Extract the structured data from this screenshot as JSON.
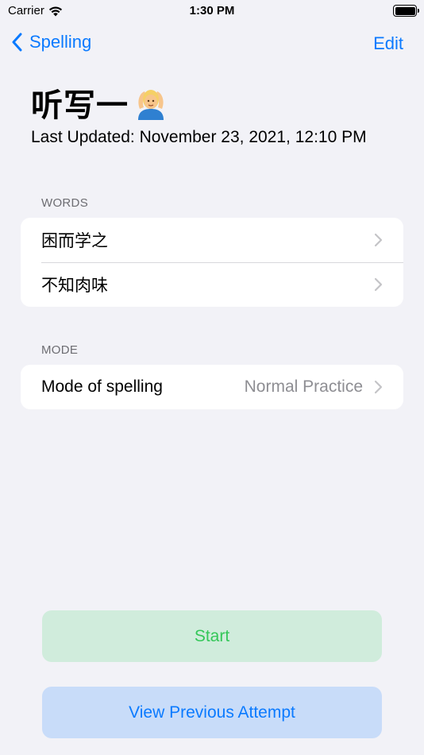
{
  "status": {
    "carrier": "Carrier",
    "time": "1:30 PM"
  },
  "nav": {
    "back_label": "Spelling",
    "edit_label": "Edit"
  },
  "header": {
    "title": "听写一",
    "updated": "Last Updated: November 23, 2021, 12:10 PM"
  },
  "words": {
    "header": "WORDS",
    "items": [
      {
        "label": "困而学之"
      },
      {
        "label": "不知肉味"
      }
    ]
  },
  "mode": {
    "header": "MODE",
    "label": "Mode of spelling",
    "value": "Normal Practice"
  },
  "buttons": {
    "start": "Start",
    "view_previous": "View Previous Attempt"
  },
  "colors": {
    "accent": "#0a7aff",
    "start_bg": "#d0ecdc",
    "start_text": "#34c759",
    "view_bg": "#c8dcf9"
  }
}
